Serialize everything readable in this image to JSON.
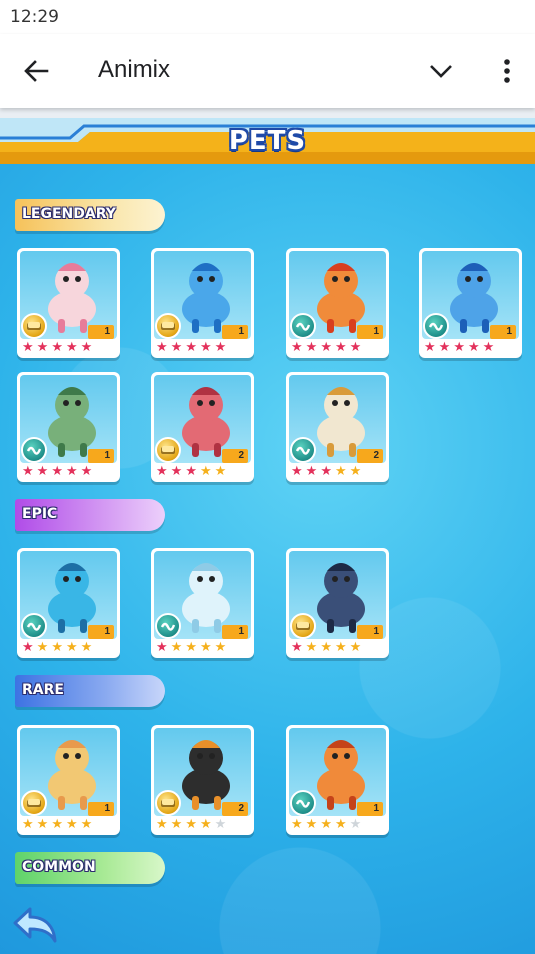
{
  "status": {
    "time": "12:29"
  },
  "app_bar": {
    "title": "Animix",
    "back_icon": "arrow-left-icon",
    "dropdown_icon": "chevron-down-icon",
    "menu_icon": "more-vert-icon"
  },
  "game": {
    "header_title": "PETS",
    "sections": {
      "legendary": {
        "label": "LEGENDARY",
        "color": "#f6c25a"
      },
      "epic": {
        "label": "EPIC",
        "color": "#b04ce8"
      },
      "rare": {
        "label": "RARE",
        "color": "#3d73e3"
      },
      "common": {
        "label": "COMMON",
        "color": "#5fd36a"
      }
    },
    "cards": [
      {
        "name": "unicorn-pet",
        "badge": "gold",
        "level": "1",
        "stars": "red5"
      },
      {
        "name": "blue-unicorn-pet",
        "badge": "gold",
        "level": "1",
        "stars": "red5"
      },
      {
        "name": "fire-phoenix-pet",
        "badge": "teal",
        "level": "1",
        "stars": "red5"
      },
      {
        "name": "blue-bird-pet",
        "badge": "teal",
        "level": "1",
        "stars": "red5"
      },
      {
        "name": "leaf-dragon-pet",
        "badge": "teal",
        "level": "1",
        "stars": "red5"
      },
      {
        "name": "pink-warrior-pet",
        "badge": "gold",
        "level": "2",
        "stars": "red3gold2"
      },
      {
        "name": "mermaid-spirit-pet",
        "badge": "teal",
        "level": "2",
        "stars": "red3gold2"
      },
      {
        "name": "hero-pet",
        "badge": "teal",
        "level": "1",
        "stars": "red1gold4"
      },
      {
        "name": "water-spirit-pet",
        "badge": "teal",
        "level": "1",
        "stars": "red1gold4"
      },
      {
        "name": "knight-pet",
        "badge": "gold",
        "level": "1",
        "stars": "red1gold4"
      },
      {
        "name": "corgi-unicorn-pet",
        "badge": "gold",
        "level": "1",
        "stars": "gold5"
      },
      {
        "name": "tiger-panda-pet",
        "badge": "gold",
        "level": "2",
        "stars": "gold4empty1"
      },
      {
        "name": "fire-owl-pet",
        "badge": "teal",
        "level": "1",
        "stars": "gold4empty1"
      }
    ],
    "return_icon": "return-arrow-icon"
  }
}
